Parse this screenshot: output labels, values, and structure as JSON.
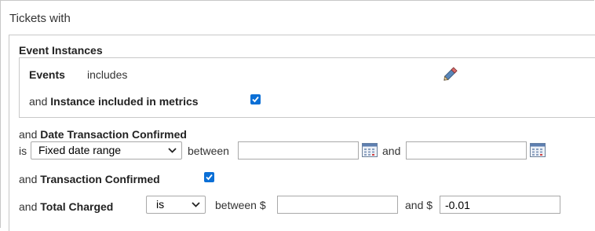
{
  "header": {
    "title": "Tickets with"
  },
  "event_instances": {
    "title": "Event Instances",
    "events_label": "Events",
    "events_op": "includes",
    "metrics_prefix": "and",
    "metrics_label": "Instance included in metrics",
    "metrics_checked": true
  },
  "date_confirmed": {
    "prefix": "and",
    "label": "Date Transaction Confirmed",
    "is_label": "is",
    "range_value": "Fixed date range",
    "between_label": "between",
    "and_label": "and",
    "start_value": "",
    "end_value": ""
  },
  "txn_confirmed": {
    "prefix": "and",
    "label": "Transaction Confirmed",
    "checked": true
  },
  "total_charged": {
    "prefix": "and",
    "label": "Total Charged",
    "op_value": "is",
    "between_label": "between $",
    "and_label": "and $",
    "min_value": "",
    "max_value": "-0.01"
  },
  "colors": {
    "checkbox": "#0b6fd6",
    "border": "#c8c8c8"
  },
  "icons": [
    "pencil-icon",
    "calendar-icon",
    "checkmark-icon",
    "chevron-down-icon"
  ]
}
